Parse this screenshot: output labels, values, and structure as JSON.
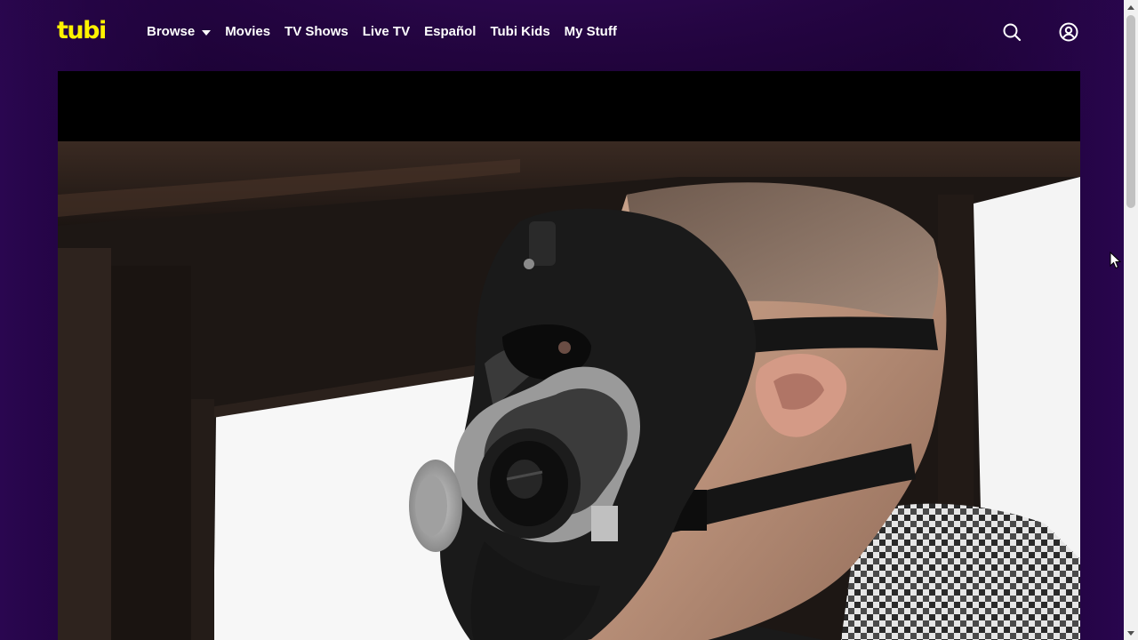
{
  "app": {
    "logo_text": "tubi",
    "brand_color": "#fff200"
  },
  "nav": {
    "browse": "Browse",
    "movies": "Movies",
    "tv_shows": "TV Shows",
    "live_tv": "Live TV",
    "espanol": "Español",
    "tubi_kids": "Tubi Kids",
    "my_stuff": "My Stuff"
  },
  "icons": {
    "search": "search-icon",
    "account": "account-icon",
    "browse_dropdown": "caret-down-icon"
  },
  "player": {
    "scene": "man-wearing-gas-mask"
  }
}
